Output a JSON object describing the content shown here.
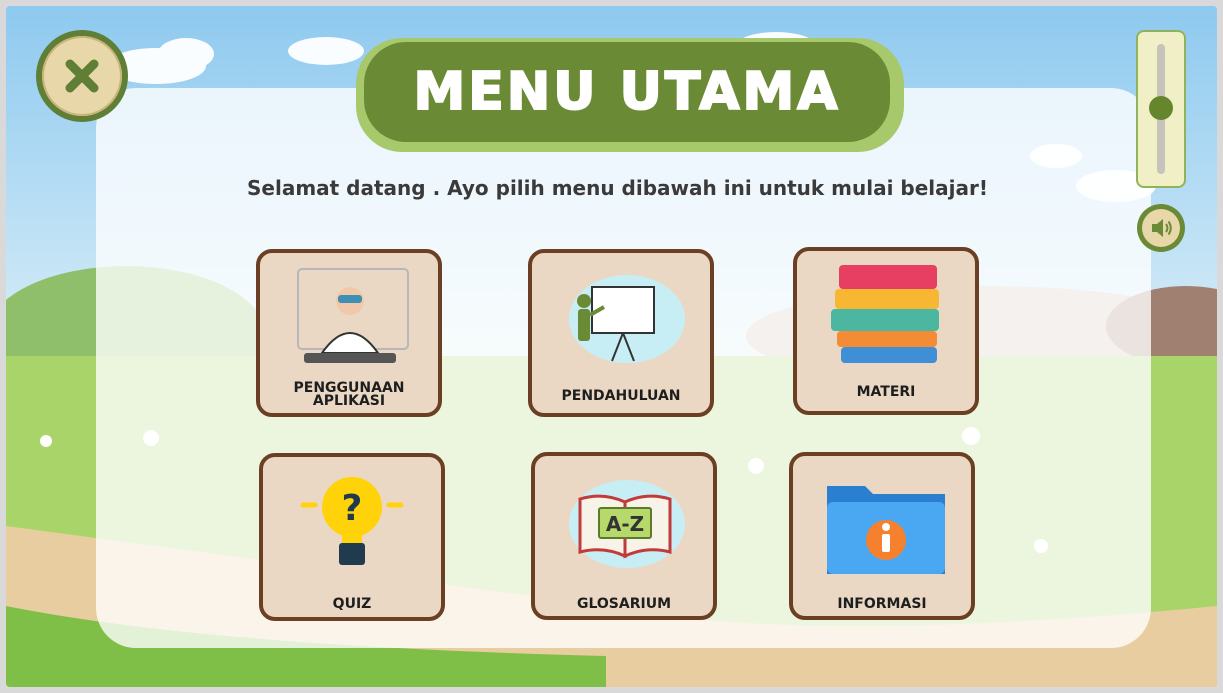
{
  "header": {
    "title": "MENU UTAMA",
    "greeting": "Selamat datang . Ayo pilih menu dibawah ini untuk mulai belajar!"
  },
  "menu": {
    "items": [
      {
        "label_line1": "PENGGUNAAN",
        "label_line2": "APLIKASI",
        "icon": "person-typing-icon"
      },
      {
        "label": "PENDAHULUAN",
        "icon": "presentation-icon"
      },
      {
        "label": "MATERI",
        "icon": "books-stack-icon"
      },
      {
        "label": "QUIZ",
        "icon": "lightbulb-question-icon"
      },
      {
        "label": "GLOSARIUM",
        "icon": "open-book-az-icon"
      },
      {
        "label": "INFORMASI",
        "icon": "info-folder-icon"
      }
    ]
  },
  "controls": {
    "close_icon": "close-icon",
    "sound_icon": "speaker-icon",
    "volume_level": 0.5
  },
  "colors": {
    "primary_green": "#6b8a36",
    "card_bg": "#ead8c5",
    "card_border": "#6b3f24"
  }
}
